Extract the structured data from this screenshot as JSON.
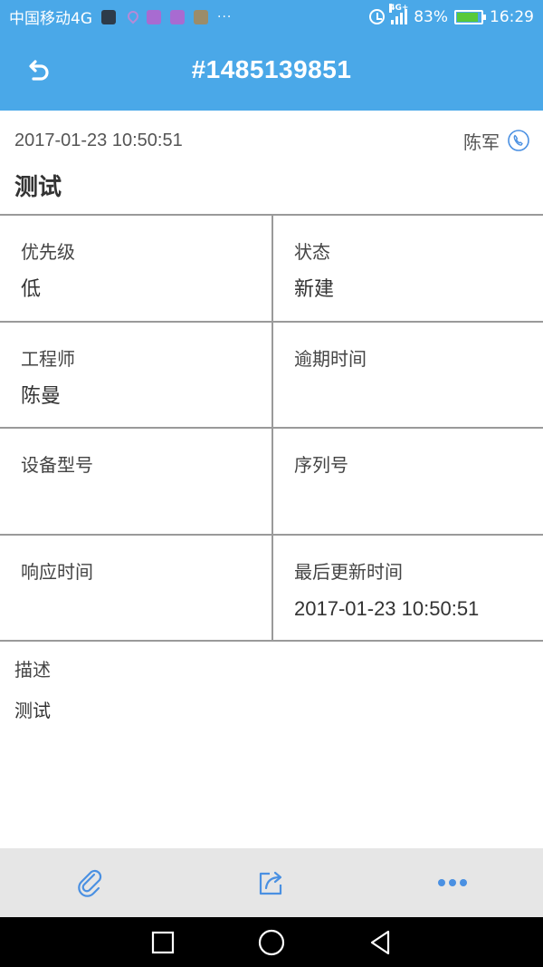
{
  "status_bar": {
    "carrier": "中国移动4G",
    "more": "···",
    "network": "4G+",
    "battery": "83%",
    "time": "16:29"
  },
  "header": {
    "title": "#1485139851",
    "back_icon": "back-arrow-icon"
  },
  "ticket": {
    "created_at": "2017-01-23 10:50:51",
    "contact_name": "陈军",
    "contact_icon": "phone-icon",
    "title": "测试"
  },
  "fields": [
    {
      "label": "优先级",
      "value": "低"
    },
    {
      "label": "状态",
      "value": "新建"
    },
    {
      "label": "工程师",
      "value": "陈曼"
    },
    {
      "label": "逾期时间",
      "value": ""
    },
    {
      "label": "设备型号",
      "value": ""
    },
    {
      "label": "序列号",
      "value": ""
    },
    {
      "label": "响应时间",
      "value": ""
    },
    {
      "label": "最后更新时间",
      "value": "2017-01-23 10:50:51"
    }
  ],
  "description": {
    "label": "描述",
    "text": "测试"
  },
  "toolbar": {
    "items": [
      "paperclip-icon",
      "share-icon",
      "more-dots-icon"
    ]
  },
  "colors": {
    "primary": "#4aa8e8",
    "icon_blue": "#4a90e2",
    "divider": "#9a9a9a",
    "toolbar_bg": "#e6e6e6"
  }
}
